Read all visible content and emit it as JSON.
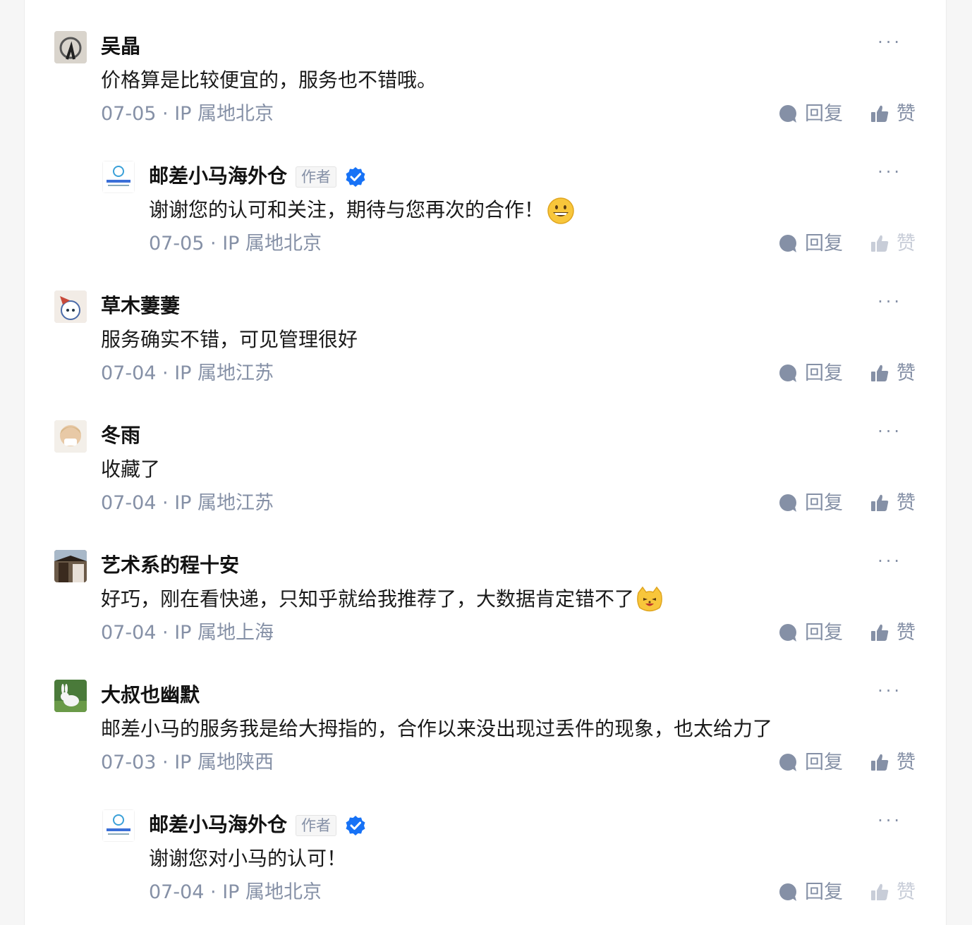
{
  "colors": {
    "meta": "#8590a6",
    "verified": "#1772f6",
    "faded_like": "#c8cdd8"
  },
  "actions": {
    "reply_label": "回复",
    "like_label": "赞",
    "more_label": "···"
  },
  "comments": [
    {
      "name": "吴晶",
      "text": "价格算是比较便宜的，服务也不错哦。",
      "meta": "07-05 · IP 属地北京",
      "is_reply": false
    },
    {
      "name": "邮差小马海外仓",
      "author_badge": "作者",
      "text": "谢谢您的认可和关注，期待与您再次的合作！",
      "emoji": "grinning-face",
      "meta": "07-05 · IP 属地北京",
      "is_reply": true
    },
    {
      "name": "草木萋萋",
      "text": "服务确实不错，可见管理很好",
      "meta": "07-04 · IP 属地江苏",
      "is_reply": false
    },
    {
      "name": "冬雨",
      "text": "收藏了",
      "meta": "07-04 · IP 属地江苏",
      "is_reply": false
    },
    {
      "name": "艺术系的程十安",
      "text": "好巧，刚在看快递，只知乎就给我推荐了，大数据肯定错不了",
      "emoji": "cat-face",
      "meta": "07-04 · IP 属地上海",
      "is_reply": false
    },
    {
      "name": "大叔也幽默",
      "text": "邮差小马的服务我是给大拇指的，合作以来没出现过丢件的现象，也太给力了",
      "meta": "07-03 · IP 属地陕西",
      "is_reply": false
    },
    {
      "name": "邮差小马海外仓",
      "author_badge": "作者",
      "text": "谢谢您对小马的认可！",
      "meta": "07-04 · IP 属地北京",
      "is_reply": true
    }
  ]
}
